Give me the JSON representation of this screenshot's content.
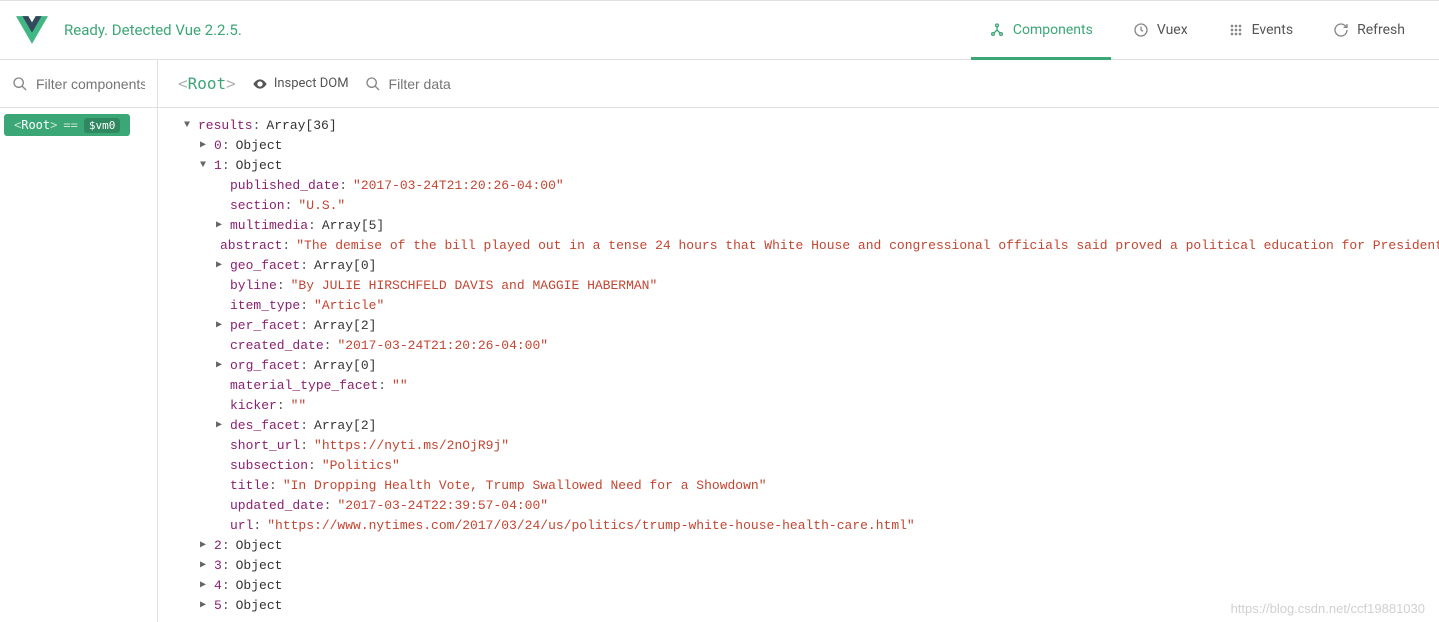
{
  "header": {
    "status": "Ready. Detected Vue 2.2.5.",
    "tabs": {
      "components": "Components",
      "vuex": "Vuex",
      "events": "Events",
      "refresh": "Refresh"
    }
  },
  "sidebar": {
    "filter_placeholder": "Filter components",
    "root": "Root",
    "eq": "==",
    "vm": "$vm0"
  },
  "toolbar": {
    "root": "Root",
    "inspect": "Inspect DOM",
    "filter_placeholder": "Filter data"
  },
  "data": {
    "results_key": "results",
    "results_type": "Array[36]",
    "items": [
      {
        "key": "0",
        "type": "Object",
        "expanded": false
      },
      {
        "key": "1",
        "type": "Object",
        "expanded": true
      },
      {
        "key": "2",
        "type": "Object",
        "expanded": false
      },
      {
        "key": "3",
        "type": "Object",
        "expanded": false
      },
      {
        "key": "4",
        "type": "Object",
        "expanded": false
      },
      {
        "key": "5",
        "type": "Object",
        "expanded": false
      }
    ],
    "item1": {
      "published_date": {
        "key": "published_date",
        "val": "\"2017-03-24T21:20:26-04:00\""
      },
      "section": {
        "key": "section",
        "val": "\"U.S.\""
      },
      "multimedia": {
        "key": "multimedia",
        "val": "Array[5]"
      },
      "abstract": {
        "key": "abstract",
        "val": "\"The demise of the bill played out in a tense 24 hours that White House and congressional officials said proved a political education for President Trump and"
      },
      "geo_facet": {
        "key": "geo_facet",
        "val": "Array[0]"
      },
      "byline": {
        "key": "byline",
        "val": "\"By JULIE HIRSCHFELD DAVIS and MAGGIE HABERMAN\""
      },
      "item_type": {
        "key": "item_type",
        "val": "\"Article\""
      },
      "per_facet": {
        "key": "per_facet",
        "val": "Array[2]"
      },
      "created_date": {
        "key": "created_date",
        "val": "\"2017-03-24T21:20:26-04:00\""
      },
      "org_facet": {
        "key": "org_facet",
        "val": "Array[0]"
      },
      "material_type_facet": {
        "key": "material_type_facet",
        "val": "\"\""
      },
      "kicker": {
        "key": "kicker",
        "val": "\"\""
      },
      "des_facet": {
        "key": "des_facet",
        "val": "Array[2]"
      },
      "short_url": {
        "key": "short_url",
        "val": "\"https://nyti.ms/2nOjR9j\""
      },
      "subsection": {
        "key": "subsection",
        "val": "\"Politics\""
      },
      "title": {
        "key": "title",
        "val": "\"In Dropping Health Vote, Trump Swallowed Need for a Showdown\""
      },
      "updated_date": {
        "key": "updated_date",
        "val": "\"2017-03-24T22:39:57-04:00\""
      },
      "url": {
        "key": "url",
        "val": "\"https://www.nytimes.com/2017/03/24/us/politics/trump-white-house-health-care.html\""
      }
    }
  },
  "watermark": "https://blog.csdn.net/ccf19881030"
}
